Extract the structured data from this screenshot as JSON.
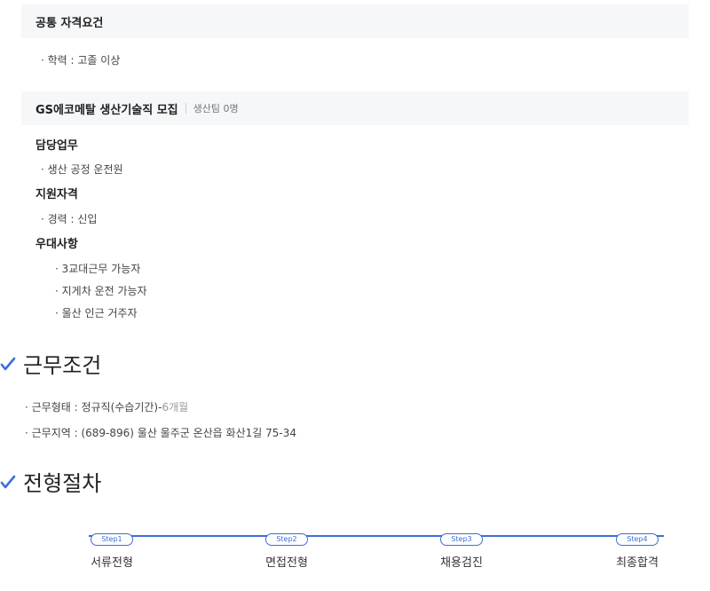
{
  "common": {
    "title": "공통 자격요건",
    "items": [
      "· 학력 : 고졸 이상"
    ]
  },
  "job": {
    "title": "GS에코메탈 생산기술직 모집",
    "subtitle": "생산팀 0명",
    "duty_heading": "담당업무",
    "duty_items": [
      "· 생산 공정 운전원"
    ],
    "qual_heading": "지원자격",
    "qual_items": [
      "· 경력 : 신입"
    ],
    "pref_heading": "우대사항",
    "pref_items": [
      "· 3교대근무 가능자",
      "· 지게차 운전 가능자",
      "· 울산 인근 거주자"
    ]
  },
  "conditions": {
    "title": "근무조건",
    "type_prefix": "· 근무형태 : 정규직(수습기간)-",
    "type_suffix": "6개월",
    "location": "· 근무지역 : (689-896) 울산 울주군 온산읍 화산1길 75-34"
  },
  "process": {
    "title": "전형절차",
    "steps": [
      {
        "badge": "Step1",
        "label": "서류전형"
      },
      {
        "badge": "Step2",
        "label": "면접전형"
      },
      {
        "badge": "Step3",
        "label": "채용검진"
      },
      {
        "badge": "Step4",
        "label": "최종합격"
      }
    ]
  },
  "colors": {
    "accent": "#3b6fd8",
    "section_bar": "#f6f7f9"
  },
  "icons": {
    "section_marker": "check-icon"
  }
}
